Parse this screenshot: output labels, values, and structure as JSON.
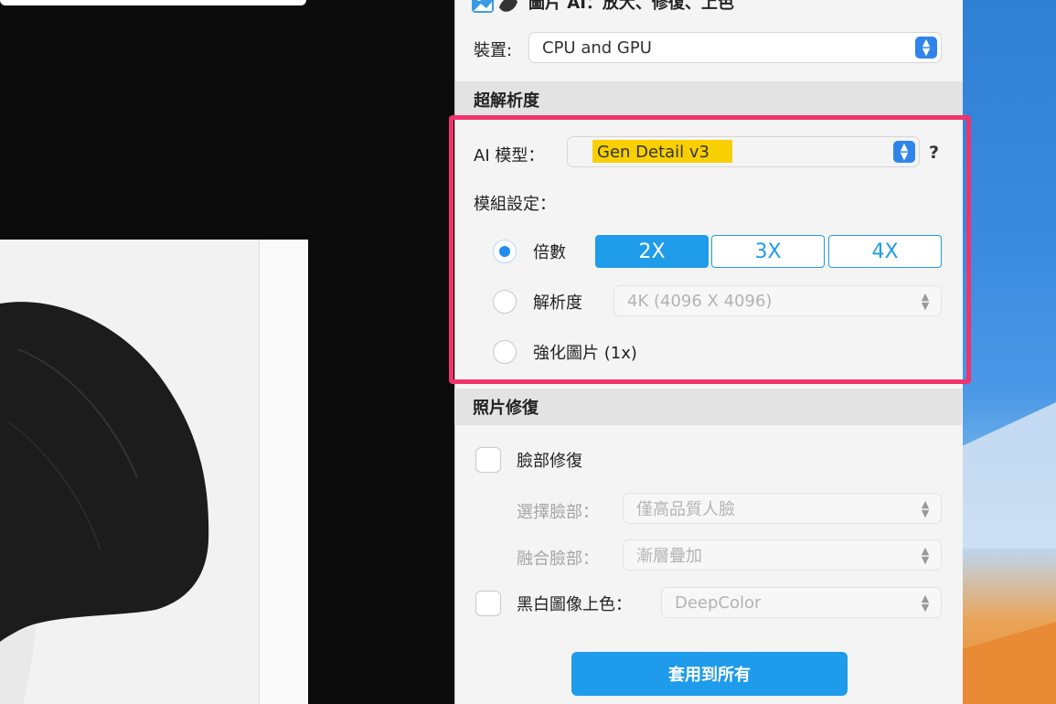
{
  "app": {
    "title": "圖片 AI：放大、修復、上色",
    "icon": "app-photo-ai-icon"
  },
  "device": {
    "label": "裝置:",
    "value": "CPU and GPU"
  },
  "super_resolution": {
    "section_title": "超解析度",
    "model_label": "AI 模型：",
    "model_value": "Gen Detail v3",
    "help": "?",
    "module_settings_label": "模組設定：",
    "options": {
      "scale": {
        "label": "倍數",
        "selected": true,
        "buttons": [
          "2X",
          "3X",
          "4X"
        ],
        "active": "2X"
      },
      "resolution": {
        "label": "解析度",
        "value": "4K (4096 X 4096)"
      },
      "enhance": {
        "label": "強化圖片 (1x)"
      }
    }
  },
  "photo_repair": {
    "section_title": "照片修復",
    "face_repair": {
      "label": "臉部修復",
      "checked": false
    },
    "select_face": {
      "label": "選擇臉部：",
      "value": "僅高品質人臉"
    },
    "blend_face": {
      "label": "融合臉部：",
      "value": "漸層疊加"
    },
    "colorize": {
      "label": "黑白圖像上色：",
      "value": "DeepColor",
      "checked": false
    }
  },
  "apply_button": "套用到所有",
  "colors": {
    "accent": "#1e9bea",
    "highlight_border": "#f0336b",
    "marker": "#f8cf00"
  }
}
